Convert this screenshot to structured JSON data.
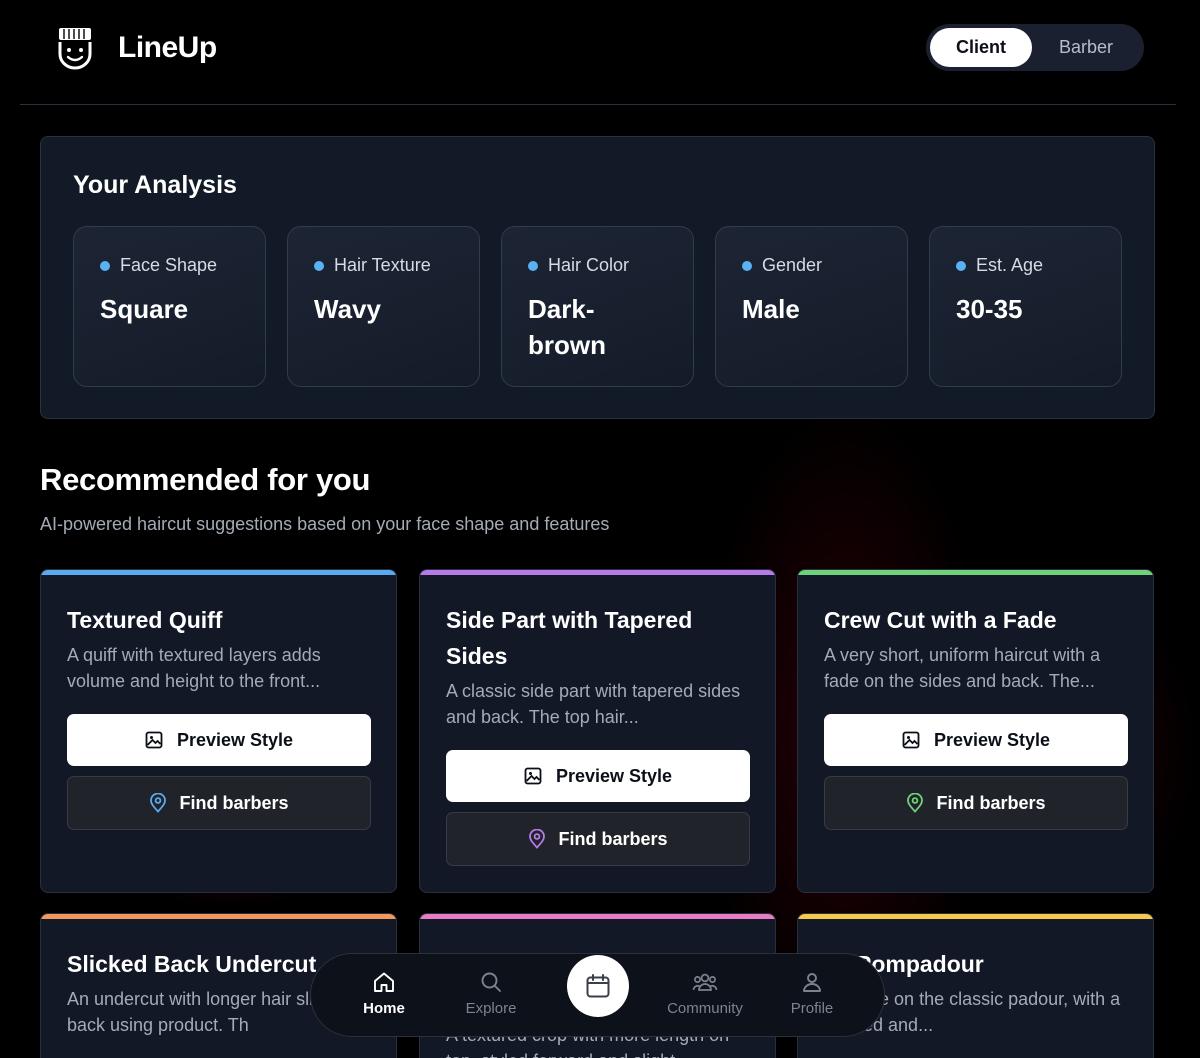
{
  "app": {
    "name": "LineUp"
  },
  "mode_toggle": {
    "client_label": "Client",
    "barber_label": "Barber",
    "active": "Client"
  },
  "analysis": {
    "title": "Your Analysis",
    "metrics": [
      {
        "label": "Face Shape",
        "value": "Square"
      },
      {
        "label": "Hair Texture",
        "value": "Wavy"
      },
      {
        "label": "Hair Color",
        "value": "Dark-brown"
      },
      {
        "label": "Gender",
        "value": "Male"
      },
      {
        "label": "Est. Age",
        "value": "30-35"
      }
    ]
  },
  "recommended": {
    "title": "Recommended for you",
    "subtitle": "AI-powered haircut suggestions based on your face shape and features",
    "preview_label": "Preview Style",
    "find_label": "Find barbers",
    "cards": [
      {
        "title": "Textured Quiff",
        "description": "A quiff with textured layers adds volume and height to the front...",
        "accent": "#5aaaf0"
      },
      {
        "title": "Side Part with Tapered Sides",
        "description": "A classic side part with tapered sides and back. The top hair...",
        "accent": "#b67be8"
      },
      {
        "title": "Crew Cut with a Fade",
        "description": "A very short, uniform haircut with a fade on the sides and back. The...",
        "accent": "#6fd17a"
      },
      {
        "title": "Slicked Back Undercut",
        "description": "An undercut with longer hair slicked back using product. Th",
        "accent": "#f0995a"
      },
      {
        "title": "",
        "description": "A textured crop with more length on top, styled forward and slight",
        "accent": "#e77bc4"
      },
      {
        "title": "sy Pompadour",
        "description": "ern take on the classic padour, with a relaxed and...",
        "accent": "#f5c94e"
      }
    ]
  },
  "bottom_nav": {
    "items": [
      {
        "label": "Home",
        "icon": "home-icon"
      },
      {
        "label": "Explore",
        "icon": "search-icon"
      },
      {
        "label": "",
        "icon": "calendar-icon"
      },
      {
        "label": "Community",
        "icon": "users-icon"
      },
      {
        "label": "Profile",
        "icon": "user-icon"
      }
    ],
    "active": "Home"
  }
}
